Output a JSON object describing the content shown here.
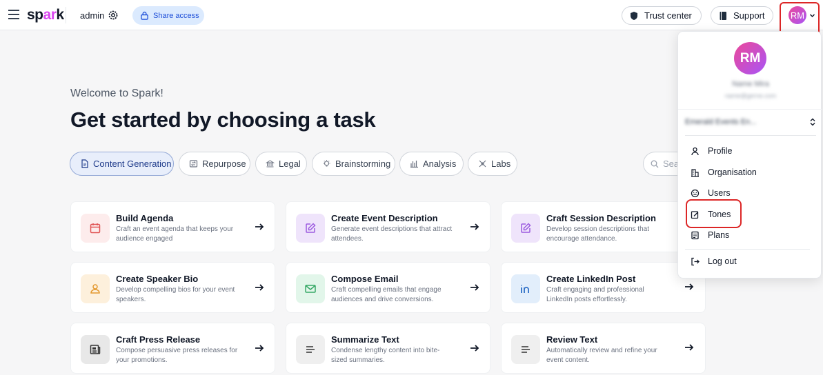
{
  "topbar": {
    "logo_prefix": "sp",
    "logo_accent": "ar",
    "logo_suffix": "k",
    "org_name": "admin",
    "share_label": "Share access",
    "trust_label": "Trust center",
    "support_label": "Support",
    "avatar_initials": "RM"
  },
  "main": {
    "welcome": "Welcome to Spark!",
    "headline": "Get started by choosing a task",
    "search_placeholder": "Sea",
    "tabs": [
      {
        "label": "Content Generation",
        "icon": "document-icon",
        "active": true
      },
      {
        "label": "Repurpose",
        "icon": "repurpose-icon"
      },
      {
        "label": "Legal",
        "icon": "bank-icon"
      },
      {
        "label": "Brainstorming",
        "icon": "lightbulb-icon"
      },
      {
        "label": "Analysis",
        "icon": "bar-chart-icon"
      },
      {
        "label": "Labs",
        "icon": "labs-icon"
      }
    ],
    "cards": [
      {
        "title": "Build Agenda",
        "desc": "Craft an event agenda that keeps your audience engaged",
        "icon": "calendar-icon",
        "bg": "#fdecec",
        "fg": "#e05353"
      },
      {
        "title": "Create Event Description",
        "desc": "Generate event descriptions that attract attendees.",
        "icon": "edit-icon",
        "bg": "#efe4fb",
        "fg": "#9b59e0"
      },
      {
        "title": "Craft Session Description",
        "desc": "Develop session descriptions that encourage attendance.",
        "icon": "edit-icon",
        "bg": "#efe4fb",
        "fg": "#9b59e0"
      },
      {
        "title": "Create Speaker Bio",
        "desc": "Develop compelling bios for your event speakers.",
        "icon": "users-icon",
        "bg": "#fdf0dc",
        "fg": "#e3982e"
      },
      {
        "title": "Compose Email",
        "desc": "Craft compelling emails that engage audiences and drive conversions.",
        "icon": "mail-icon",
        "bg": "#e2f6ea",
        "fg": "#36a866"
      },
      {
        "title": "Create LinkedIn Post",
        "desc": "Craft engaging and professional LinkedIn posts effortlessly.",
        "icon": "linkedin-icon",
        "bg": "#e2eefb",
        "fg": "#2f6fc7"
      },
      {
        "title": "Craft Press Release",
        "desc": "Compose persuasive press releases for your promotions.",
        "icon": "newspaper-icon",
        "bg": "#e8e8e8",
        "fg": "#333333"
      },
      {
        "title": "Summarize Text",
        "desc": "Condense lengthy content into bite-sized summaries.",
        "icon": "text-lines-icon",
        "bg": "#efefef",
        "fg": "#333333"
      },
      {
        "title": "Review Text",
        "desc": "Automatically review and refine your event content.",
        "icon": "text-lines-icon",
        "bg": "#efefef",
        "fg": "#333333"
      }
    ]
  },
  "dropdown": {
    "avatar_initials": "RM",
    "user_name": "Name Mira",
    "user_email": "name@gerne.com",
    "org_select": "Emerald Events En...",
    "items": [
      {
        "label": "Profile",
        "icon": "user-icon"
      },
      {
        "label": "Organisation",
        "icon": "building-icon"
      },
      {
        "label": "Users",
        "icon": "smiley-icon"
      },
      {
        "label": "Tones",
        "icon": "tone-edit-icon"
      },
      {
        "label": "Plans",
        "icon": "file-list-icon"
      },
      {
        "label": "Log out",
        "icon": "logout-icon"
      }
    ]
  },
  "colors": {
    "accent": "#d946ef",
    "highlight": "#dc2626",
    "share_bg": "#dbeafe",
    "active_tab_bg": "#e8eefb"
  }
}
